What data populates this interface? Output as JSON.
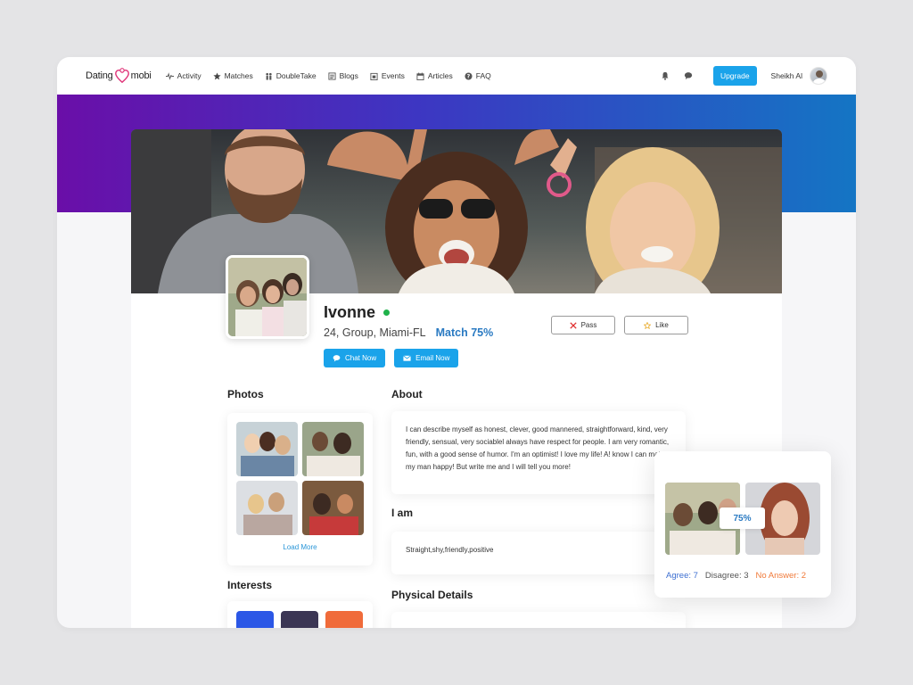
{
  "brand": {
    "left": "Dating",
    "right": "mobi",
    "accent": "#e0367a"
  },
  "nav": {
    "items": [
      {
        "label": "Activity",
        "icon": "activity-icon"
      },
      {
        "label": "Matches",
        "icon": "star-icon"
      },
      {
        "label": "DoubleTake",
        "icon": "people-icon"
      },
      {
        "label": "Blogs",
        "icon": "blog-icon"
      },
      {
        "label": "Events",
        "icon": "event-icon"
      },
      {
        "label": "Articles",
        "icon": "calendar-icon"
      },
      {
        "label": "FAQ",
        "icon": "help-icon"
      }
    ],
    "upgrade": "Upgrade",
    "user_name": "Sheikh Al"
  },
  "profile": {
    "name": "Ivonne",
    "status": "online",
    "meta": "24, Group, Miami-FL",
    "match": "Match 75%",
    "chat_label": "Chat Now",
    "email_label": "Email Now",
    "pass_label": "Pass",
    "like_label": "Like"
  },
  "sections": {
    "photos": "Photos",
    "load_more": "Load More",
    "interests": "Interests",
    "about": "About",
    "i_am": "I am",
    "physical": "Physical Details"
  },
  "about_text": "I can describe myself as honest, clever, good mannered, straightforward, kind, very friendly, sensual, very sociablel always have respect for people. I am very romantic, fun, with a good sense of humor. I'm an optimist! I love my life! A! know I can make my man happy! But write me and I will tell you more!",
  "i_am_text": "Straight,shy,friendly,positive",
  "compatibility": {
    "percent": "75%",
    "agree": "Agree: 7",
    "disagree": "Disagree: 3",
    "no_answer": "No Answer: 2"
  },
  "colors": {
    "accent": "#1aa3ea",
    "banner_start": "#6a0ea8",
    "banner_end": "#1475c4",
    "online": "#1fb24a",
    "match": "#2a7ac2",
    "no_answer": "#f07a3a"
  }
}
